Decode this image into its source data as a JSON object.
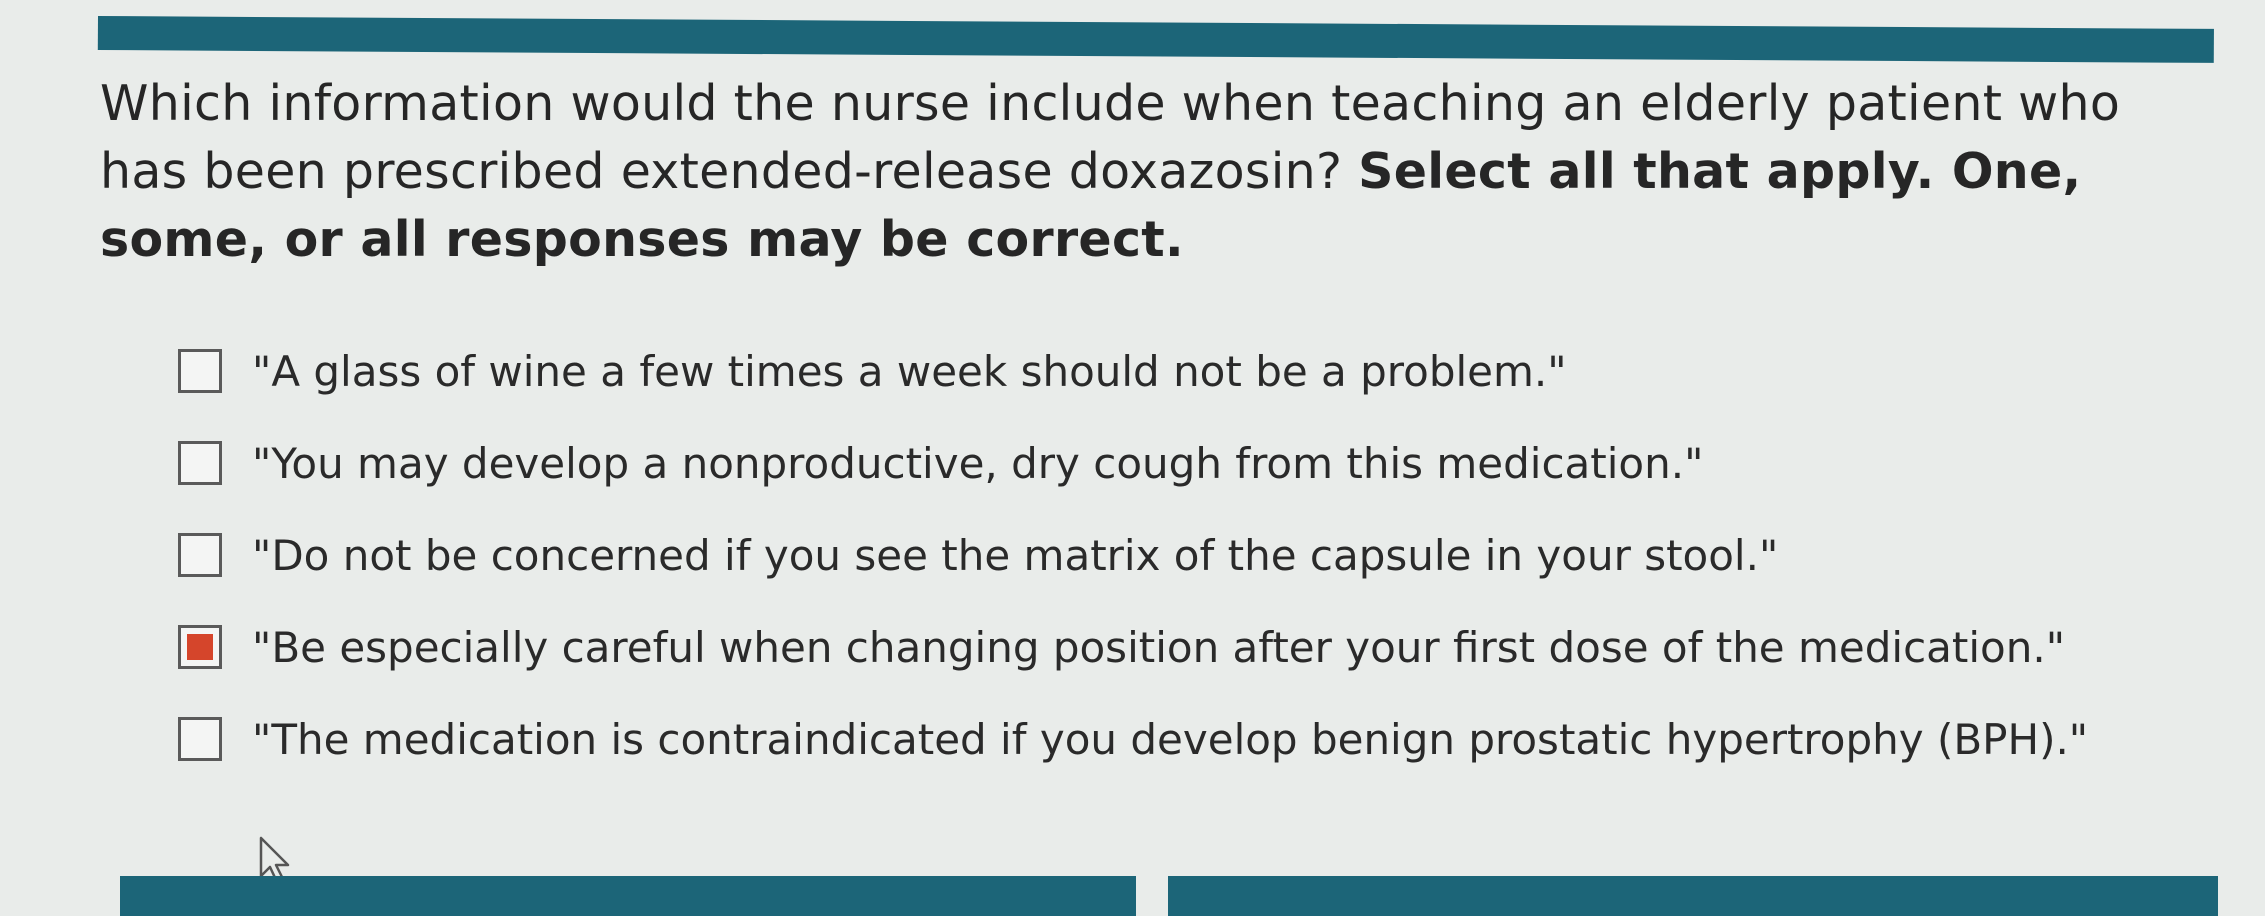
{
  "question": {
    "text_regular": "Which information would the nurse include when teaching an elderly patient who has been prescribed extended-release doxazosin? ",
    "text_bold": "Select all that apply. One, some, or all responses may be correct."
  },
  "options": [
    {
      "label": "\"A glass of wine a few times a week should not be a problem.\"",
      "checked": false
    },
    {
      "label": "\"You may develop a nonproductive, dry cough from this medication.\"",
      "checked": false
    },
    {
      "label": "\"Do not be concerned if you see the matrix of the capsule in your stool.\"",
      "checked": false
    },
    {
      "label": "\"Be especially careful when changing position after your first dose of the medication.\"",
      "checked": true
    },
    {
      "label": "\"The medication is contraindicated if you develop benign prostatic hypertrophy (BPH).\"",
      "checked": false
    }
  ],
  "colors": {
    "accent": "#1c6578",
    "checked_fill": "#d5452b",
    "background": "#e9ecea"
  },
  "icons": {
    "cursor": "arrow-cursor-icon"
  }
}
